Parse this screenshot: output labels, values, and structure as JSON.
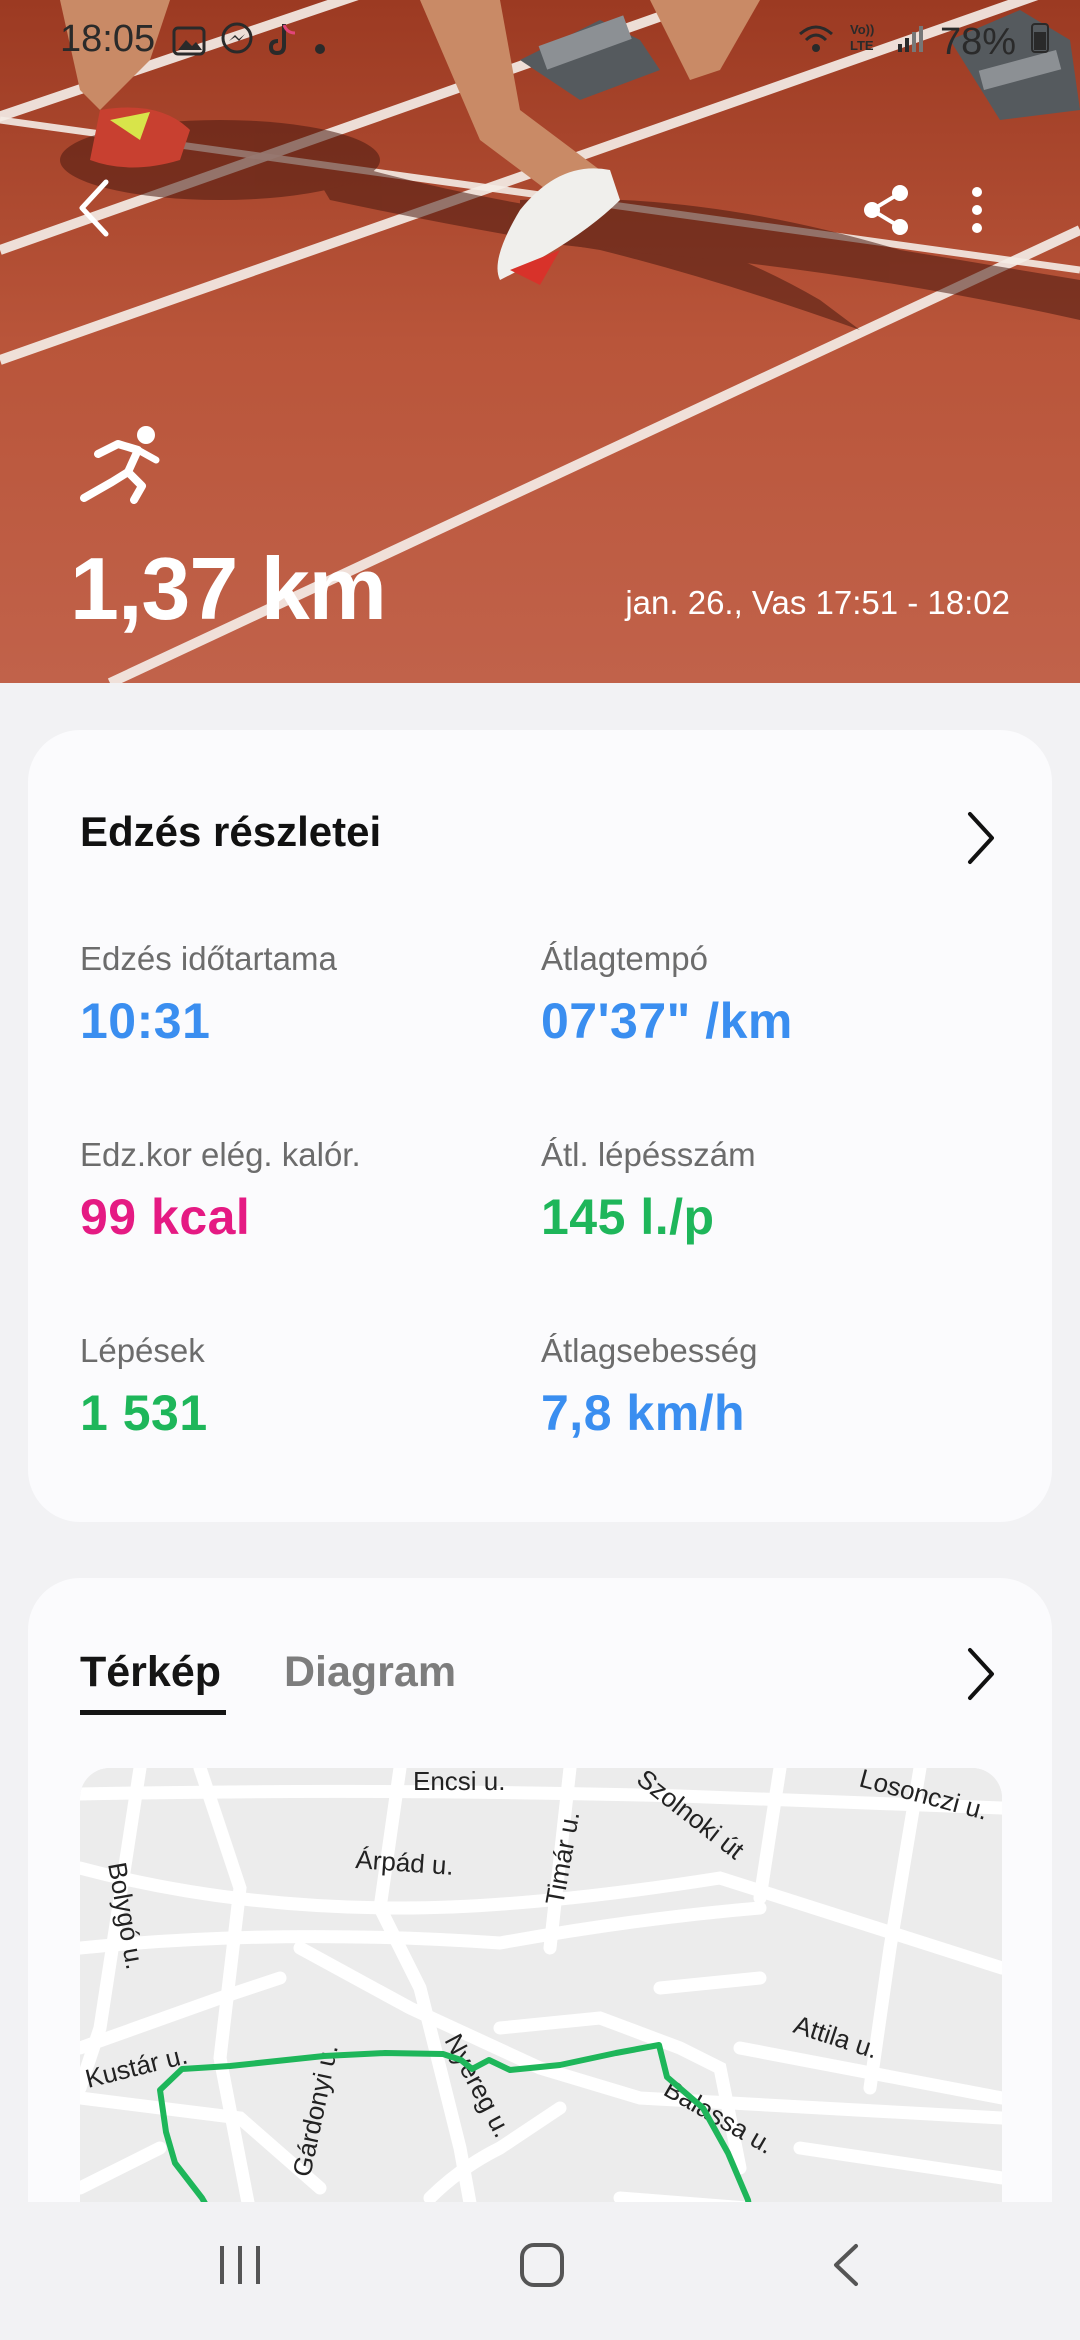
{
  "status_bar": {
    "time": "18:05",
    "battery": "78%",
    "notification_icons": [
      "gallery-icon",
      "messenger-icon",
      "tiktok-icon",
      "dot-icon"
    ],
    "system_icons": [
      "wifi-icon",
      "volte-icon",
      "signal-icon",
      "battery-icon"
    ]
  },
  "hero": {
    "activity_icon": "running-icon",
    "distance": "1,37 km",
    "datetime": "jan. 26., Vas 17:51 - 18:02",
    "back_icon": "back-arrow-icon",
    "share_icon": "share-icon",
    "menu_icon": "more-vert-icon"
  },
  "details": {
    "title": "Edzés részletei",
    "metrics": [
      {
        "label": "Edzés időtartama",
        "value": "10:31",
        "color": "#3a8ef0"
      },
      {
        "label": "Átlagtempó",
        "value": "07'37\" /km",
        "color": "#3a8ef0"
      },
      {
        "label": "Edz.kor elég. kalór.",
        "value": "99 kcal",
        "color": "#e51a83"
      },
      {
        "label": "Átl. lépésszám",
        "value": "145 l./p",
        "color": "#1eb65a"
      },
      {
        "label": "Lépések",
        "value": "1 531",
        "color": "#1eb65a"
      },
      {
        "label": "Átlagsebesség",
        "value": "7,8 km/h",
        "color": "#3a8ef0"
      }
    ]
  },
  "map_card": {
    "tabs": [
      "Térkép",
      "Diagram"
    ],
    "active_tab": "Térkép",
    "route_color": "#1eb65a",
    "streets": [
      "Encsi u.",
      "Szolnoki út",
      "Losonczi u.",
      "Árpád u.",
      "Timár u.",
      "Bolygó u.",
      "Attila u.",
      "Kustár u.",
      "Gárdonyi u.",
      "Nyereg u.",
      "Balassa u."
    ]
  },
  "nav_bar": {
    "items": [
      "recent-apps-icon",
      "home-icon",
      "back-icon"
    ]
  }
}
